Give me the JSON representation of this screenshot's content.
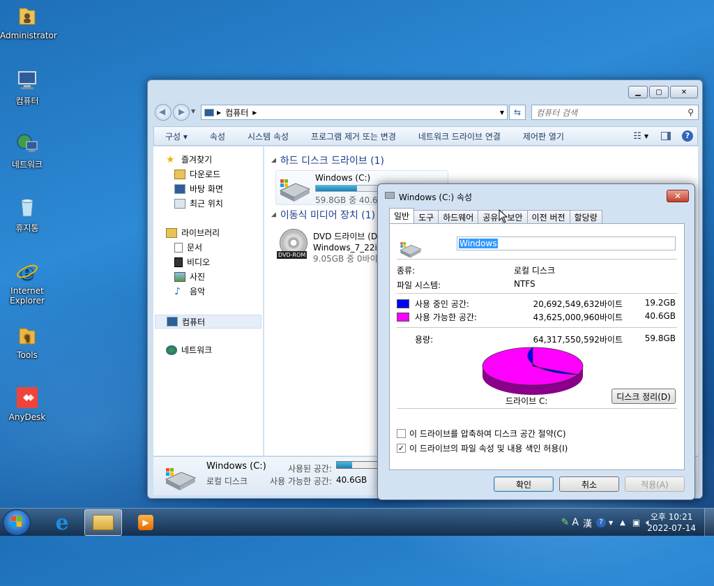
{
  "desktop": {
    "icons": [
      {
        "label": "Administrator"
      },
      {
        "label": "컴퓨터"
      },
      {
        "label": "네트워크"
      },
      {
        "label": "휴지통"
      },
      {
        "label": "Internet Explorer"
      },
      {
        "label": "Tools"
      },
      {
        "label": "AnyDesk"
      }
    ]
  },
  "explorer": {
    "address_path": "컴퓨터",
    "search_placeholder": "컴퓨터 검색",
    "commands": [
      "구성 ▾",
      "속성",
      "시스템 속성",
      "프로그램 제거 또는 변경",
      "네트워크 드라이브 연결",
      "제어판 열기"
    ],
    "nav": {
      "favorites": "즐겨찾기",
      "downloads": "다운로드",
      "desktop": "바탕 화면",
      "recent": "최근 위치",
      "libraries": "라이브러리",
      "documents": "문서",
      "videos": "비디오",
      "pictures": "사진",
      "music": "음악",
      "computer": "컴퓨터",
      "network": "네트워크"
    },
    "hdd_group": "하드 디스크 드라이브 (1)",
    "hdd": {
      "name": "Windows (C:)",
      "space": "59.8GB 중 40.6GB",
      "used_fraction": 0.32
    },
    "removable_group": "이동식 미디어 장치 (1)",
    "dvd": {
      "name": "DVD 드라이브 (D:)",
      "label": "Windows_7_22in1",
      "space": "9.05GB 중 0바이트",
      "badge": "DVD-ROM"
    },
    "details": {
      "name": "Windows (C:)",
      "type": "로컬 디스크",
      "used_label": "사용된 공간:",
      "free_label": "사용 가능한 공간:",
      "free_value": "40.6GB"
    }
  },
  "properties": {
    "title": "Windows (C:) 속성",
    "tabs": [
      "일반",
      "도구",
      "하드웨어",
      "공유",
      "보안",
      "이전 버전",
      "할당량"
    ],
    "active_tab": 0,
    "drive_name": "Windows",
    "type_label": "종류:",
    "type_value": "로컬 디스크",
    "fs_label": "파일 시스템:",
    "fs_value": "NTFS",
    "used_label": "사용 중인 공간:",
    "used_bytes": "20,692,549,632바이트",
    "used_gb": "19.2GB",
    "free_label": "사용 가능한 공간:",
    "free_bytes": "43,625,000,960바이트",
    "free_gb": "40.6GB",
    "cap_label": "용량:",
    "cap_bytes": "64,317,550,592바이트",
    "cap_gb": "59.8GB",
    "drive_caption": "드라이브 C:",
    "cleanup_button": "디스크 정리(D)",
    "compress_label": "이 드라이브를 압축하여 디스크 공간 절약(C)",
    "compress_checked": false,
    "index_label": "이 드라이브의 파일 속성 및 내용 색인 허용(I)",
    "index_checked": true,
    "ok": "확인",
    "cancel": "취소",
    "apply": "적용(A)",
    "used_color": "#0000ff",
    "free_color": "#ff00ff",
    "used_fraction": 0.322
  },
  "taskbar": {
    "tray_lang": "A",
    "tray_hanja": "漢",
    "time": "오후 10:21",
    "date": "2022-07-14"
  }
}
